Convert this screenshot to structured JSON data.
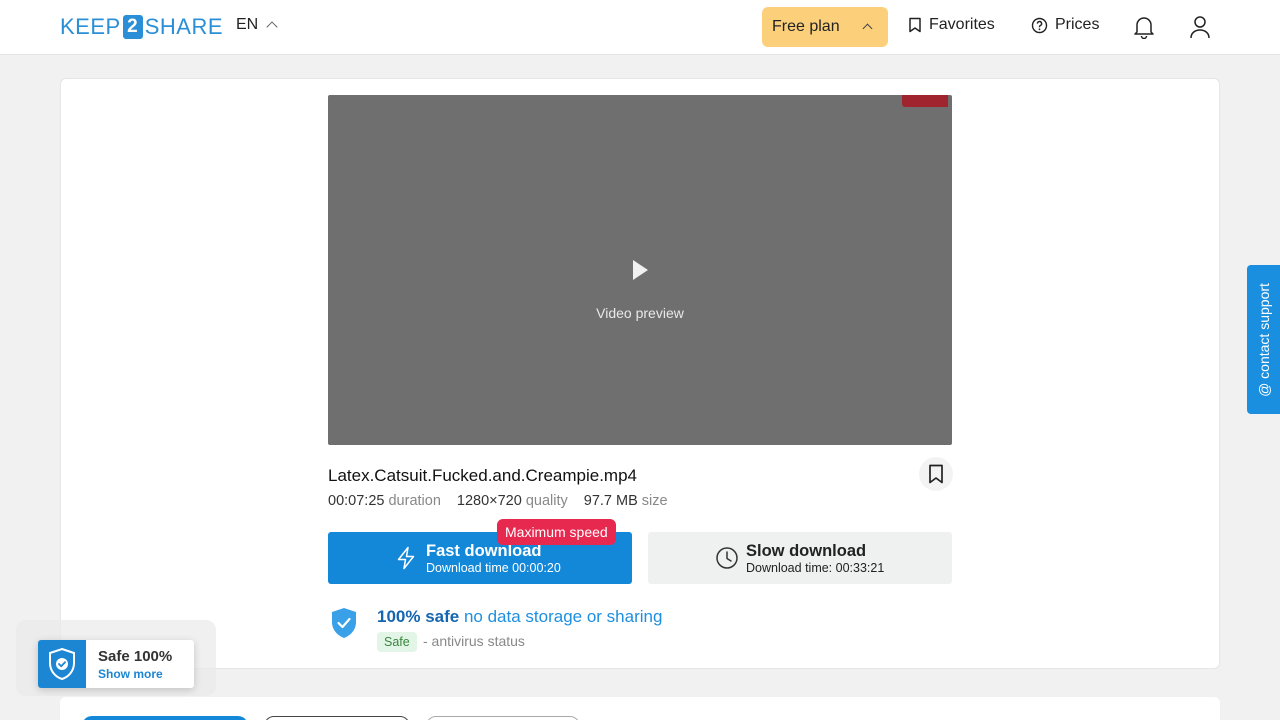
{
  "header": {
    "logo_left": "KEEP",
    "logo_mid": "2",
    "logo_right": "SHARE",
    "language": "EN",
    "free_plan": "Free plan",
    "favorites": "Favorites",
    "prices": "Prices"
  },
  "video": {
    "note": "Video preview"
  },
  "file": {
    "name": "Latex.Catsuit.Fucked.and.Creampie.mp4",
    "duration_value": "00:07:25",
    "duration_label": "duration",
    "quality_value": "1280×720",
    "quality_label": "quality",
    "size_value": "97.7 MB",
    "size_label": "size"
  },
  "downloads": {
    "max_speed_badge": "Maximum speed",
    "fast_title": "Fast download",
    "fast_sub": "Download time 00:00:20",
    "slow_title": "Slow download",
    "slow_sub": "Download time: 00:33:21"
  },
  "safety": {
    "title_bold": "100% safe",
    "title_rest": " no data storage or sharing",
    "tag": "Safe",
    "status": "- antivirus status"
  },
  "support": {
    "label": "@ contact support"
  },
  "safe_popup": {
    "title": "Safe 100%",
    "link": "Show more"
  },
  "colors": {
    "accent": "#1388d9",
    "free_plan_bg": "#fcd07a",
    "badge_red": "#e7294f"
  }
}
